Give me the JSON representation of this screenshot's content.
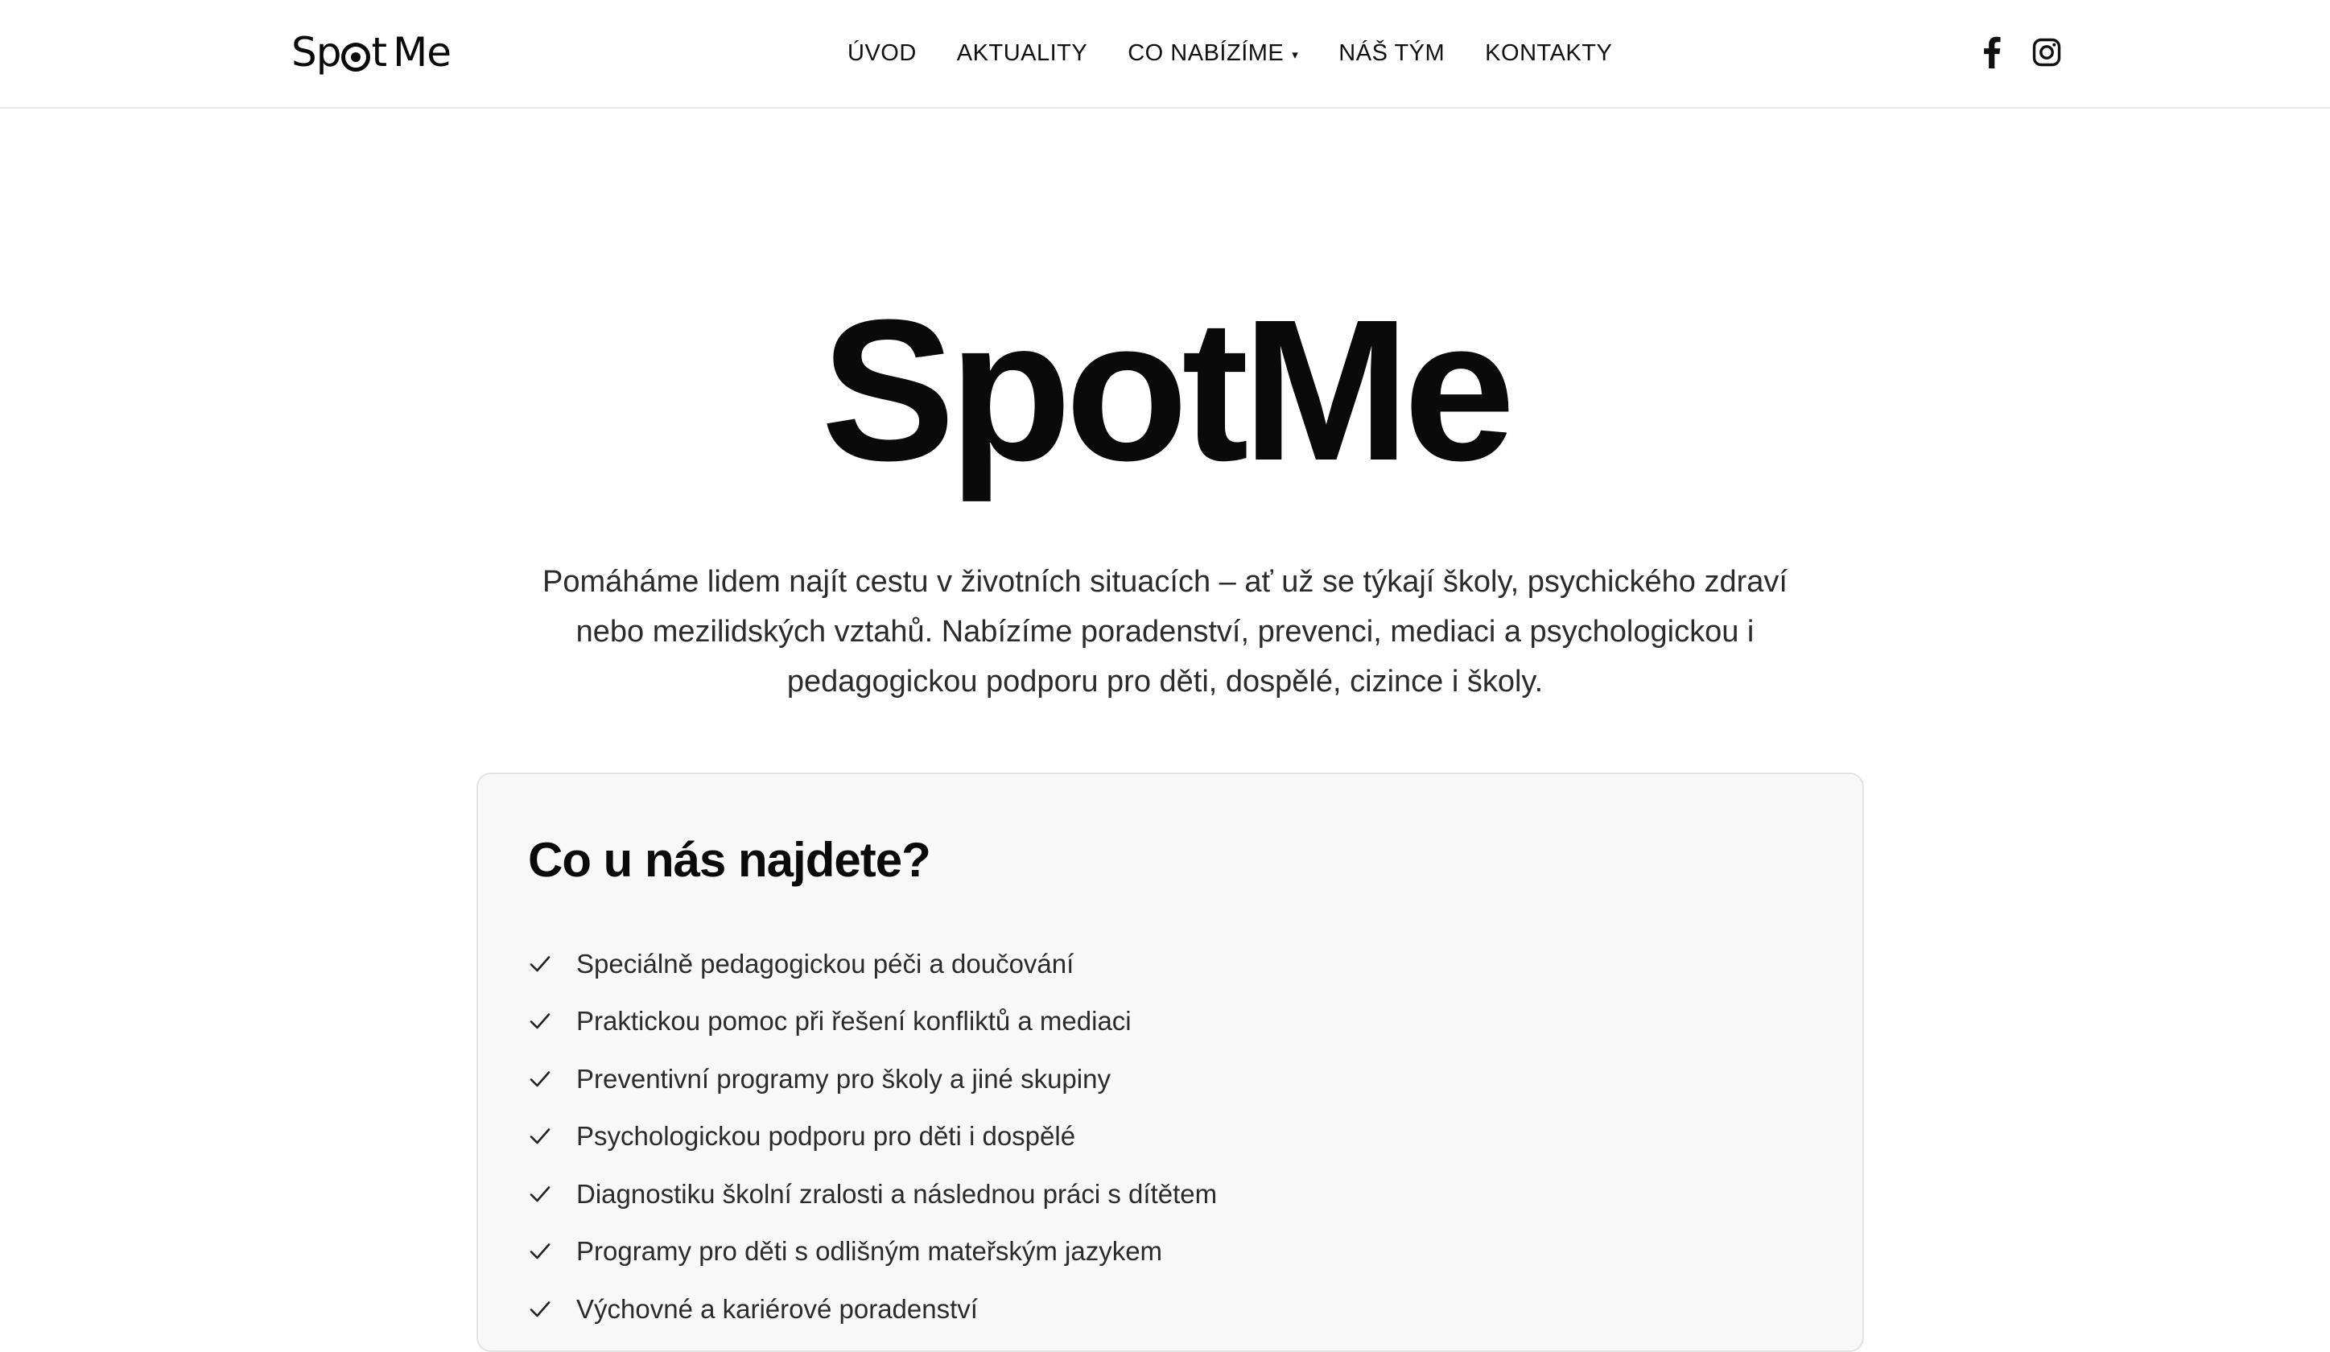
{
  "header": {
    "logo": {
      "part1": "Sp",
      "part2": "t",
      "part3": "Me"
    },
    "nav": [
      {
        "label": "ÚVOD"
      },
      {
        "label": "AKTUALITY"
      },
      {
        "label": "CO NABÍZÍME",
        "caret": "▾"
      },
      {
        "label": "NÁŠ TÝM"
      },
      {
        "label": "KONTAKTY"
      }
    ],
    "social": [
      "facebook-icon",
      "instagram-icon"
    ]
  },
  "hero": {
    "title": "SpotMe",
    "lead": "Pomáháme lidem najít cestu v životních situacích – ať už se týkají školy, psychického zdraví nebo mezilidských vztahů. Nabízíme poradenství, prevenci, mediaci a psychologickou i pedagogickou podporu pro děti, dospělé, cizince i školy."
  },
  "features": {
    "title": "Co u nás najdete?",
    "items": [
      "Speciálně pedagogickou péči a doučování",
      "Praktickou pomoc při řešení konfliktů a mediaci",
      "Preventivní programy pro školy a jiné skupiny",
      "Psychologickou podporu pro děti i dospělé",
      "Diagnostiku školní zralosti a následnou práci s dítětem",
      "Programy pro děti s odlišným mateřským jazykem",
      "Výchovné a kariérové poradenství"
    ]
  },
  "colors": {
    "text": "#111111",
    "body_text": "#2b2b2b",
    "card_background": "#f8f8f8",
    "card_border": "#e3e3e3",
    "header_border": "#e6e6e6"
  }
}
